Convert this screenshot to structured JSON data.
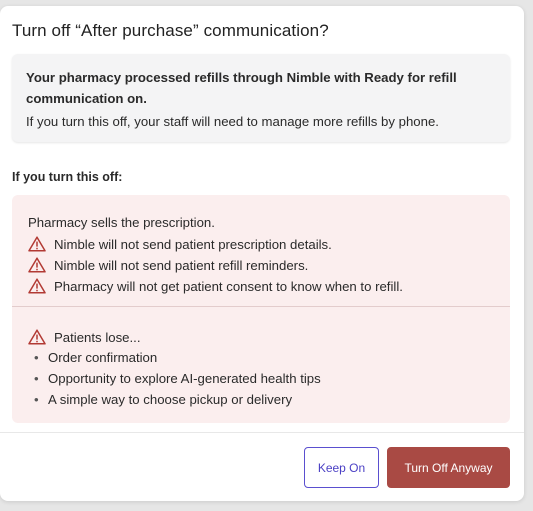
{
  "dialog": {
    "title": "Turn off “After purchase” communication?"
  },
  "info": {
    "bold_text": "Your pharmacy processed refills through Nimble with Ready for refill communication on.",
    "text": "If you turn this off, your staff will need to manage more refills by phone."
  },
  "section_heading": "If you turn this off:",
  "consequences": {
    "intro": "Pharmacy sells the prescription.",
    "warnings": [
      "Nimble will not send patient prescription details.",
      "Nimble will not send patient refill reminders.",
      "Pharmacy will not get patient consent to know when to refill."
    ],
    "patients_heading": "Patients lose...",
    "patient_losses": [
      "Order confirmation",
      "Opportunity to explore AI-generated health tips",
      "A simple way to choose pickup or delivery"
    ]
  },
  "buttons": {
    "keep_on": "Keep On",
    "turn_off": "Turn Off Anyway"
  },
  "colors": {
    "warning_red": "#b23a34",
    "primary_danger": "#a94a44",
    "secondary_border": "#5a4fcf",
    "consequence_bg": "#fbeeee"
  },
  "icons": {
    "warning": "warning-triangle-icon",
    "bullet": "bullet-dot"
  }
}
